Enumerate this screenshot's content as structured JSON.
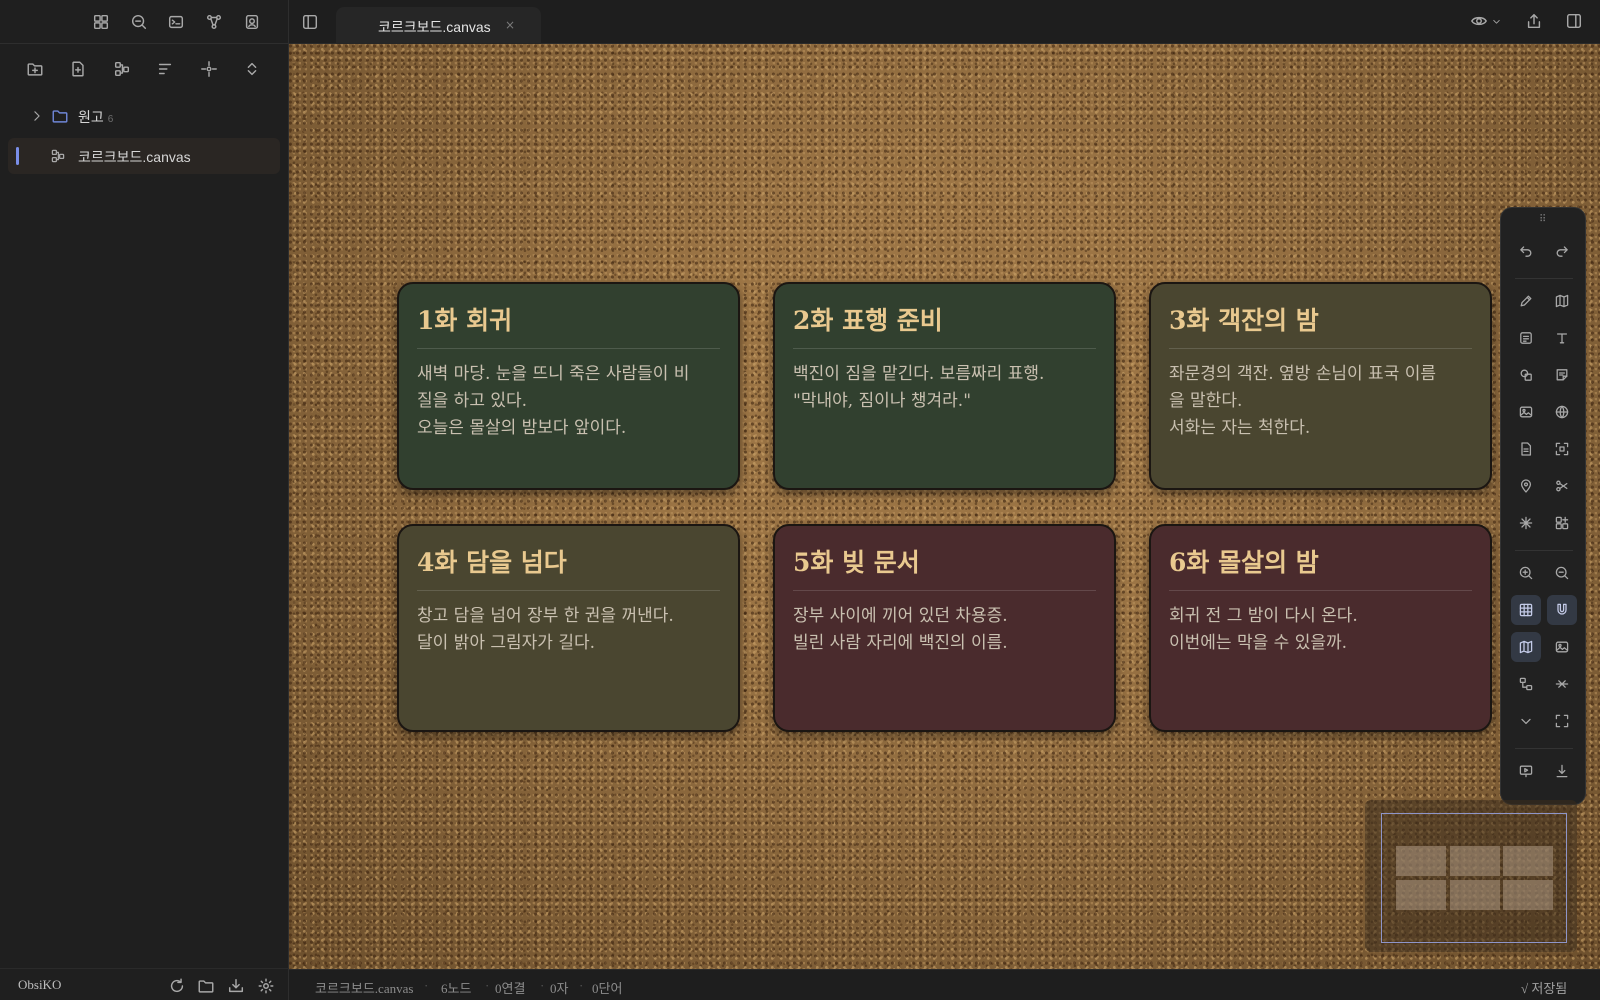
{
  "app": {
    "vault_name": "ObsiKO"
  },
  "tab": {
    "label": "코르크보드.canvas",
    "close": "×"
  },
  "sidebar": {
    "tree": [
      {
        "type": "folder",
        "name": "원고",
        "count": "6"
      },
      {
        "type": "canvas",
        "name": "코르크보드.canvas",
        "active": true
      }
    ]
  },
  "cards": [
    {
      "title": "1화 회귀",
      "lines": [
        "새벽 마당. 눈을 뜨니 죽은 사람들이 비",
        "질을 하고 있다.",
        "오늘은 몰살의 밤보다 앞이다."
      ],
      "color": "green"
    },
    {
      "title": "2화 표행 준비",
      "lines": [
        "백진이 짐을 맡긴다. 보름짜리 표행.",
        "\"막내야, 짐이나 챙겨라.\""
      ],
      "color": "green"
    },
    {
      "title": "3화 객잔의 밤",
      "lines": [
        "좌문경의 객잔. 옆방 손님이 표국 이름",
        "을 말한다.",
        "서화는 자는 척한다."
      ],
      "color": "olive"
    },
    {
      "title": "4화 담을 넘다",
      "lines": [
        "창고 담을 넘어 장부 한 권을 꺼낸다.",
        "달이 밝아 그림자가 길다."
      ],
      "color": "olive"
    },
    {
      "title": "5화 빚 문서",
      "lines": [
        "장부 사이에 끼어 있던 차용증.",
        "빌린 사람 자리에 백진의 이름."
      ],
      "color": "wine"
    },
    {
      "title": "6화 몰살의 밤",
      "lines": [
        "회귀 전 그 밤이 다시 온다.",
        "이번에는 막을 수 있을까."
      ],
      "color": "wine"
    }
  ],
  "status": {
    "file": "코르크보드.canvas",
    "nodes": "6노드",
    "links": "0연결",
    "chars": "0자",
    "words": "0단어",
    "saved": "√ 저장됨"
  },
  "colors": {
    "card_green": "#31402f",
    "card_olive": "#4a4630",
    "card_wine": "#4a2b2d",
    "title_gold": "#e9c98f",
    "accent": "#7a8ee8"
  }
}
